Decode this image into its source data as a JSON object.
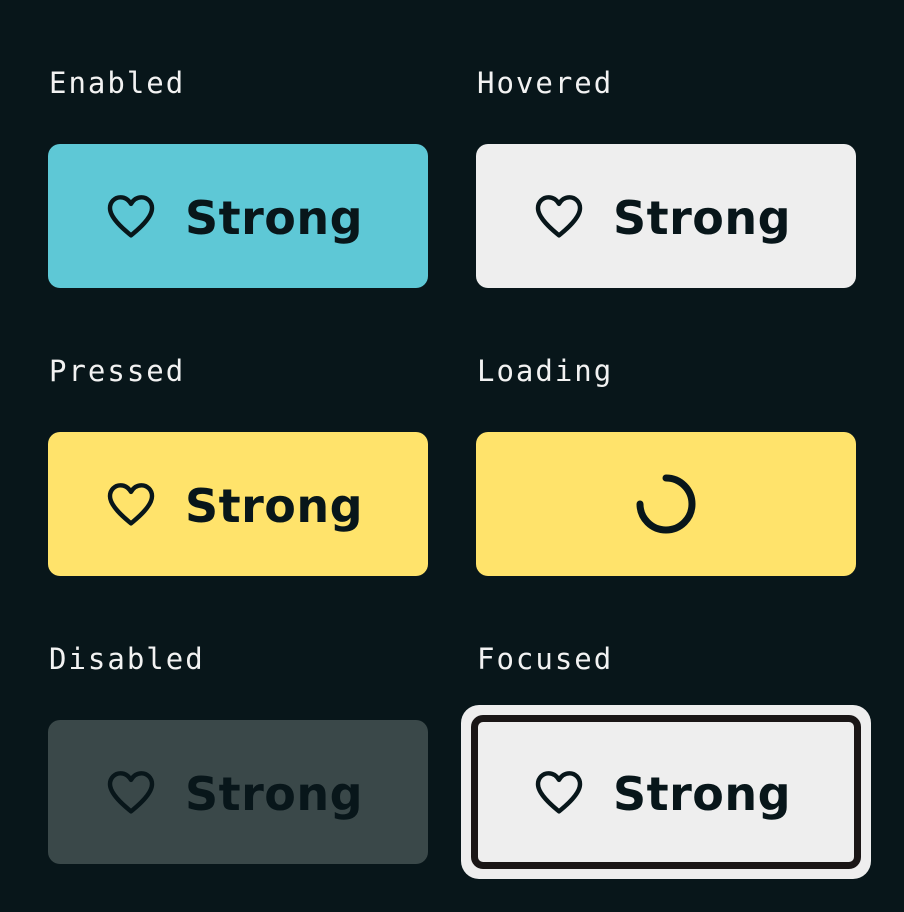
{
  "colors": {
    "background": "#08161a",
    "enabled_bg": "#5ec8d6",
    "hovered_bg": "#eeeeee",
    "pressed_bg": "#ffe36b",
    "loading_bg": "#ffe36b",
    "disabled_bg": "#3a4849",
    "focused_bg": "#eeeeee",
    "ink": "#08161a",
    "label": "#f2f2f2"
  },
  "states": {
    "enabled": {
      "label": "Enabled",
      "button_text": "Strong",
      "icon": "heart-outline-icon"
    },
    "hovered": {
      "label": "Hovered",
      "button_text": "Strong",
      "icon": "heart-outline-icon"
    },
    "pressed": {
      "label": "Pressed",
      "button_text": "Strong",
      "icon": "heart-outline-icon"
    },
    "loading": {
      "label": "Loading",
      "icon": "loading-spinner-icon"
    },
    "disabled": {
      "label": "Disabled",
      "button_text": "Strong",
      "icon": "heart-outline-icon"
    },
    "focused": {
      "label": "Focused",
      "button_text": "Strong",
      "icon": "heart-outline-icon"
    }
  }
}
